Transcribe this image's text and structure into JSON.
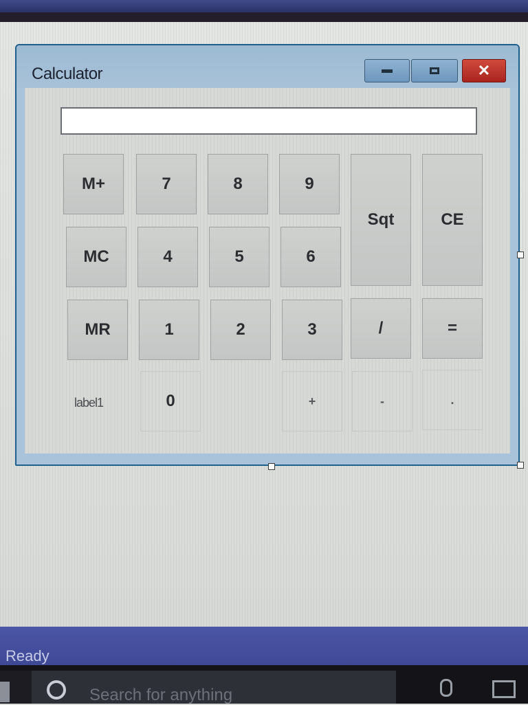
{
  "window": {
    "title": "Calculator",
    "controls": {
      "minimize": "minimize",
      "maximize": "maximize",
      "close": "✕"
    }
  },
  "calculator": {
    "display_value": "",
    "keys": {
      "m_plus": "M+",
      "seven": "7",
      "eight": "8",
      "nine": "9",
      "sqt": "Sqt",
      "ce": "CE",
      "mc": "MC",
      "four": "4",
      "five": "5",
      "six": "6",
      "mr": "MR",
      "one": "1",
      "two": "2",
      "three": "3",
      "divide": "/",
      "equals": "=",
      "zero": "0",
      "plus": "+",
      "minus": "-",
      "dot": "."
    },
    "label1": "label1"
  },
  "status_bar": {
    "text": "Ready"
  },
  "taskbar": {
    "search_placeholder": "Search for anything"
  },
  "colors": {
    "window_border": "#1f5f8c",
    "title_bar": "#a7c2d8",
    "close_button": "#c0392b",
    "status_bar": "#4650a0",
    "taskbar": "#141418"
  }
}
